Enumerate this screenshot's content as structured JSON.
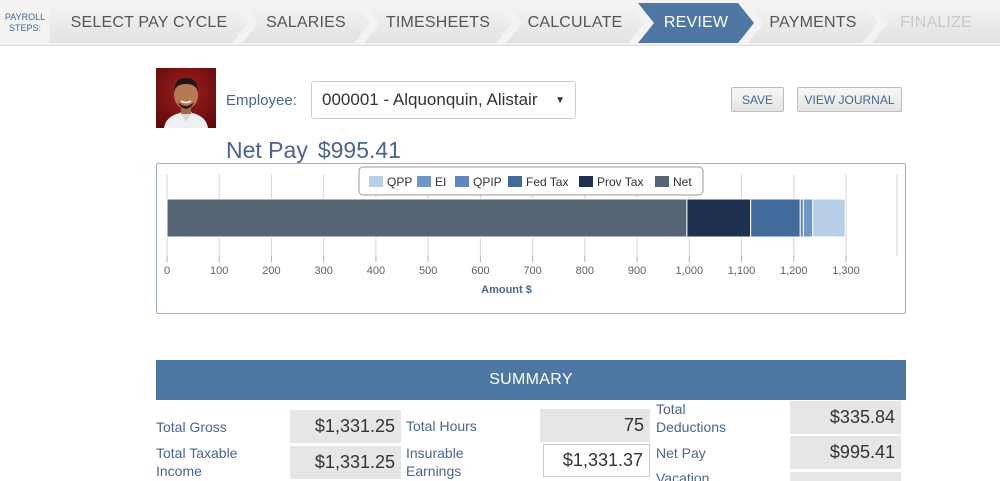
{
  "steps": {
    "label_line1": "PAYROLL",
    "label_line2": "STEPS:",
    "items": [
      {
        "label": "SELECT PAY CYCLE",
        "state": "normal"
      },
      {
        "label": "SALARIES",
        "state": "normal"
      },
      {
        "label": "TIMESHEETS",
        "state": "normal"
      },
      {
        "label": "CALCULATE",
        "state": "normal"
      },
      {
        "label": "REVIEW",
        "state": "active"
      },
      {
        "label": "PAYMENTS",
        "state": "normal"
      },
      {
        "label": "FINALIZE",
        "state": "disabled"
      }
    ]
  },
  "employee": {
    "label": "Employee:",
    "selected": "000001 - Alquonquin, Alistair"
  },
  "actions": {
    "save": "SAVE",
    "view_journal": "VIEW JOURNAL"
  },
  "net_pay": {
    "label": "Net Pay",
    "amount": "$995.41"
  },
  "chart_data": {
    "type": "bar",
    "orientation": "horizontal",
    "stacked": true,
    "xlabel": "Amount $",
    "xlim": [
      0,
      1300
    ],
    "ticks": [
      {
        "v": 0,
        "label": "0"
      },
      {
        "v": 100,
        "label": "100"
      },
      {
        "v": 200,
        "label": "200"
      },
      {
        "v": 300,
        "label": "300"
      },
      {
        "v": 400,
        "label": "400"
      },
      {
        "v": 500,
        "label": "500"
      },
      {
        "v": 600,
        "label": "600"
      },
      {
        "v": 700,
        "label": "700"
      },
      {
        "v": 800,
        "label": "800"
      },
      {
        "v": 900,
        "label": "900"
      },
      {
        "v": 1000,
        "label": "1,000"
      },
      {
        "v": 1100,
        "label": "1,100"
      },
      {
        "v": 1200,
        "label": "1,200"
      },
      {
        "v": 1300,
        "label": "1,300"
      }
    ],
    "legend": [
      {
        "name": "QPP",
        "color": "#b7cfe6"
      },
      {
        "name": "EI",
        "color": "#6f98c9"
      },
      {
        "name": "QPIP",
        "color": "#5d88bd"
      },
      {
        "name": "Fed Tax",
        "color": "#426a9a"
      },
      {
        "name": "Prov Tax",
        "color": "#1d3050"
      },
      {
        "name": "Net",
        "color": "#566576"
      }
    ],
    "segments": [
      {
        "name": "Net",
        "value": 995.41,
        "color": "#566576"
      },
      {
        "name": "Prov Tax",
        "value": 122,
        "color": "#1d3050"
      },
      {
        "name": "Fed Tax",
        "value": 95,
        "color": "#426a9a"
      },
      {
        "name": "QPIP",
        "value": 6,
        "color": "#5d88bd"
      },
      {
        "name": "EI",
        "value": 18,
        "color": "#6f98c9"
      },
      {
        "name": "QPP",
        "value": 62,
        "color": "#b7cfe6"
      }
    ],
    "legend_position": "top-center"
  },
  "summary": {
    "title": "SUMMARY",
    "total_gross_label": "Total Gross",
    "total_gross": "$1,331.25",
    "total_taxable_label_1": "Total Taxable",
    "total_taxable_label_2": "Income",
    "total_taxable": "$1,331.25",
    "total_hours_label": "Total Hours",
    "total_hours": "75",
    "insurable_label_1": "Insurable",
    "insurable_label_2": "Earnings",
    "insurable": "$1,331.37",
    "total_deductions_label_1": "Total",
    "total_deductions_label_2": "Deductions",
    "total_deductions": "$335.84",
    "net_pay_label": "Net Pay",
    "net_pay": "$995.41",
    "vacation_label": "Vacation"
  }
}
